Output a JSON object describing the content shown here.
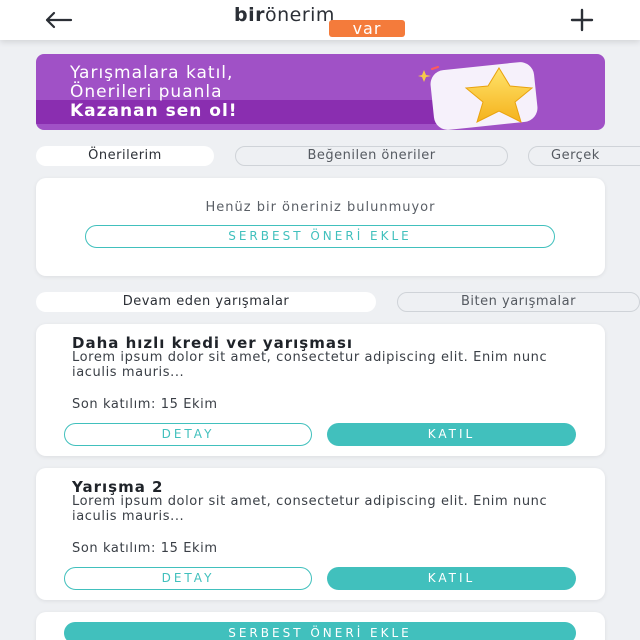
{
  "header": {
    "back_icon": "arrow-left-icon",
    "add_icon": "plus-icon",
    "logo": {
      "bir": "bir",
      "onerim": "önerim",
      "var": "var"
    },
    "brand_color": "#f47b3b"
  },
  "banner": {
    "line1": "Yarışmalara katıl,",
    "line2": "Önerileri puanla",
    "line3": "Kazanan sen ol!",
    "background": "#a051c6",
    "icon": "star-icon"
  },
  "tabs_top": [
    {
      "label": "Önerilerim",
      "active": true
    },
    {
      "label": "Beğenilen öneriler",
      "active": false
    },
    {
      "label": "Gerçek",
      "active": false
    }
  ],
  "empty_state": {
    "message": "Henüz bir öneriniz bulunmuyor",
    "button": "SERBEST ÖNERİ EKLE"
  },
  "tabs_contests": [
    {
      "label": "Devam eden yarışmalar",
      "active": true
    },
    {
      "label": "Biten yarışmalar",
      "active": false
    }
  ],
  "contests": [
    {
      "title": "Daha hızlı kredi ver yarışması",
      "description": "Lorem ipsum dolor sit amet, consectetur adipiscing elit. Enim nunc iaculis mauris...",
      "deadline": "Son katılım: 15 Ekim",
      "detail_button": "DETAY",
      "join_button": "KATIL"
    },
    {
      "title": "Yarışma 2",
      "description": "Lorem ipsum dolor sit amet, consectetur adipiscing elit. Enim nunc iaculis mauris...",
      "deadline": "Son katılım: 15 Ekim",
      "detail_button": "DETAY",
      "join_button": "KATIL"
    }
  ],
  "bottom_button": "SERBEST ÖNERİ EKLE",
  "accent_color": "#41c0bd"
}
